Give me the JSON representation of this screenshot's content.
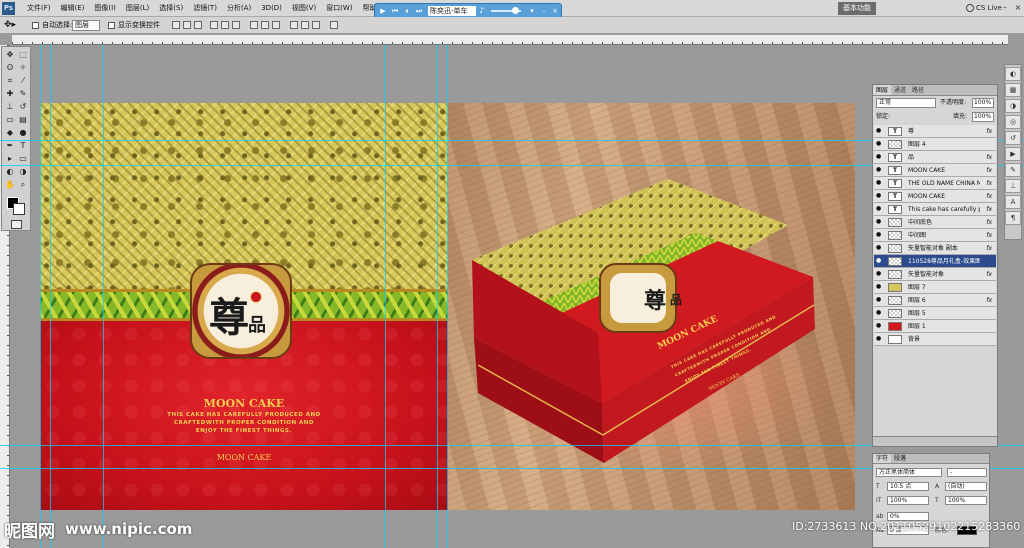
{
  "app": {
    "logo": "Ps",
    "menus": [
      "文件(F)",
      "编辑(E)",
      "图像(I)",
      "图层(L)",
      "选择(S)",
      "滤镜(T)",
      "分析(A)",
      "3D(D)",
      "视图(V)",
      "窗口(W)",
      "帮助(H)"
    ],
    "workspace_label": "基本功能",
    "cs_live_label": "CS Live",
    "window_controls": [
      "–",
      "□",
      "×"
    ]
  },
  "media_player": {
    "track": "陈奕迅-单车",
    "buttons": [
      "play-icon",
      "prev-icon",
      "pause-icon",
      "next-icon"
    ],
    "volume": 0.8
  },
  "options_bar": {
    "auto_select_label": "自动选择:",
    "auto_select_value": "图层",
    "show_transform_label": "显示变换控件"
  },
  "tools": [
    "move-icon",
    "marquee-icon",
    "lasso-icon",
    "magic-wand-icon",
    "crop-icon",
    "eyedropper-icon",
    "healing-icon",
    "brush-icon",
    "clone-stamp-icon",
    "history-brush-icon",
    "eraser-icon",
    "gradient-icon",
    "blur-icon",
    "dodge-icon",
    "pen-icon",
    "type-icon",
    "path-select-icon",
    "shape-icon",
    "hand-icon",
    "zoom-icon"
  ],
  "colors": {
    "foreground": "#000000",
    "background": "#ffffff",
    "accent": "#2b4b8c",
    "gold": "#f6cf52",
    "box_red": "#d4161d"
  },
  "artwork": {
    "emblem_char_big": "尊",
    "emblem_char_small": "品",
    "title": "MOON CAKE",
    "body_lines": [
      "THIS CAKE HAS CAREFULLY PRODUCED AND",
      "CRAFTEDWITH PROPER CONDITION AND",
      "ENJOY THE FINEST THINGS."
    ],
    "footer": "MOON CAKE"
  },
  "layers_panel": {
    "tabs": [
      "图层",
      "通道",
      "路径"
    ],
    "blend_mode": "正常",
    "opacity_label": "不透明度:",
    "opacity_value": "100%",
    "lock_label": "锁定:",
    "fill_label": "填充:",
    "fill_value": "100%",
    "layers": [
      {
        "name": "尊",
        "thumb": "T",
        "kind": "text",
        "fx": "fx"
      },
      {
        "name": "图层 4",
        "thumb": "",
        "kind": "check",
        "fx": ""
      },
      {
        "name": "品",
        "thumb": "T",
        "kind": "text",
        "fx": "fx"
      },
      {
        "name": "MOON CAKE",
        "thumb": "T",
        "kind": "text",
        "fx": "fx"
      },
      {
        "name": "THE OLD NAME CHINA M...",
        "thumb": "T",
        "kind": "text",
        "fx": "fx"
      },
      {
        "name": "MOON CAKE",
        "thumb": "T",
        "kind": "text",
        "fx": "fx"
      },
      {
        "name": "This cake has carefully p...",
        "thumb": "T",
        "kind": "text",
        "fx": "fx"
      },
      {
        "name": "中间底色",
        "thumb": "",
        "kind": "check",
        "fx": "fx"
      },
      {
        "name": "中间图",
        "thumb": "",
        "kind": "check",
        "fx": "fx"
      },
      {
        "name": "矢量智能对象 副本",
        "thumb": "",
        "kind": "check",
        "fx": "fx"
      },
      {
        "name": "110528尊品月礼盒-效果图",
        "thumb": "",
        "kind": "check",
        "fx": ""
      },
      {
        "name": "矢量智能对象",
        "thumb": "",
        "kind": "check",
        "fx": "fx"
      },
      {
        "name": "图层 7",
        "thumb": "",
        "kind": "yellow",
        "fx": ""
      },
      {
        "name": "图层 6",
        "thumb": "",
        "kind": "check",
        "fx": "fx"
      },
      {
        "name": "图层 5",
        "thumb": "",
        "kind": "check",
        "fx": ""
      },
      {
        "name": "图层 1",
        "thumb": "",
        "kind": "red",
        "fx": ""
      },
      {
        "name": "背景",
        "thumb": "",
        "kind": "white",
        "fx": ""
      }
    ],
    "selected_index": 10
  },
  "character_panel": {
    "tabs": [
      "字符",
      "段落"
    ],
    "font_family": "方正黑体简体",
    "font_style": "-",
    "font_size": "10.5 点",
    "leading": "(自动)",
    "vertical_scale": "100%",
    "horizontal_scale": "100%",
    "tracking": "0%",
    "baseline": "0 点",
    "color_label": "颜色:"
  },
  "watermark": {
    "site_logo": "昵图网",
    "site_url": "www.nipic.com",
    "id_text": "ID:2733613 NO:20110529102215283360"
  }
}
